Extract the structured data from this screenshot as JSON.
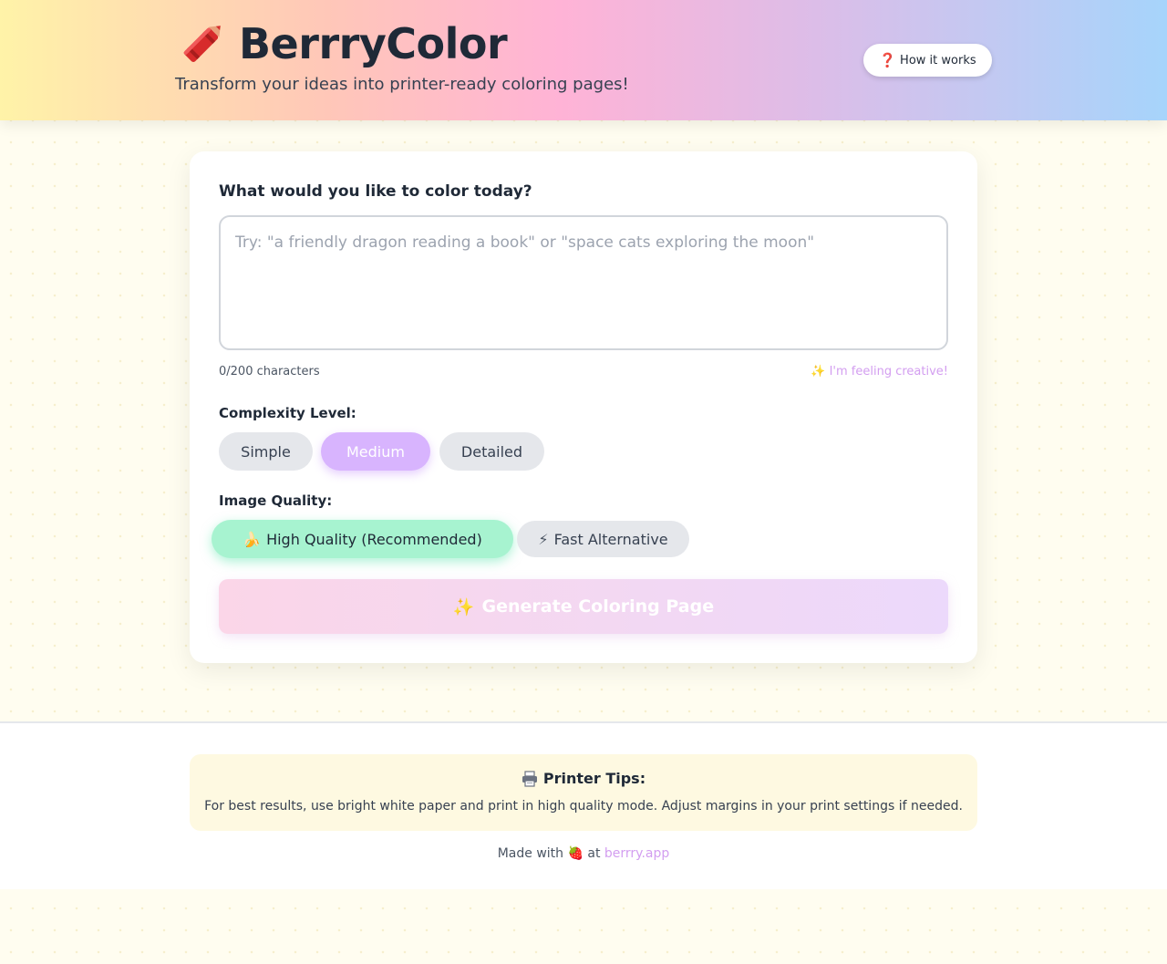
{
  "header": {
    "app_title": "BerrryColor",
    "tagline": "Transform your ideas into printer-ready coloring pages!",
    "how_it_works_label": "How it works",
    "how_it_works_icon": "❓"
  },
  "form": {
    "prompt_label": "What would you like to color today?",
    "prompt_placeholder": "Try: \"a friendly dragon reading a book\" or \"space cats exploring the moon\"",
    "prompt_value": "",
    "char_count": "0/200 characters",
    "creative_link": "✨ I'm feeling creative!",
    "complexity_label": "Complexity Level:",
    "complexity_options": [
      "Simple",
      "Medium",
      "Detailed"
    ],
    "complexity_selected": "Medium",
    "quality_label": "Image Quality:",
    "quality_options": [
      {
        "icon": "🍌",
        "label": "High Quality (Recommended)"
      },
      {
        "icon": "⚡",
        "label": "Fast Alternative"
      }
    ],
    "quality_selected": "High Quality (Recommended)",
    "generate_icon": "✨",
    "generate_label": "Generate Coloring Page"
  },
  "footer": {
    "tips_title": "Printer Tips:",
    "tips_text": "For best results, use bright white paper and print in high quality mode. Adjust margins in your print settings if needed.",
    "made_with_prefix": "Made with",
    "made_with_icon": "🍓",
    "made_with_at": "at",
    "link_text": "berrry.app"
  },
  "colors": {
    "accent_purple": "#d8b4fe",
    "accent_green": "#a7f3d0",
    "link_purple": "#d39ef0"
  }
}
